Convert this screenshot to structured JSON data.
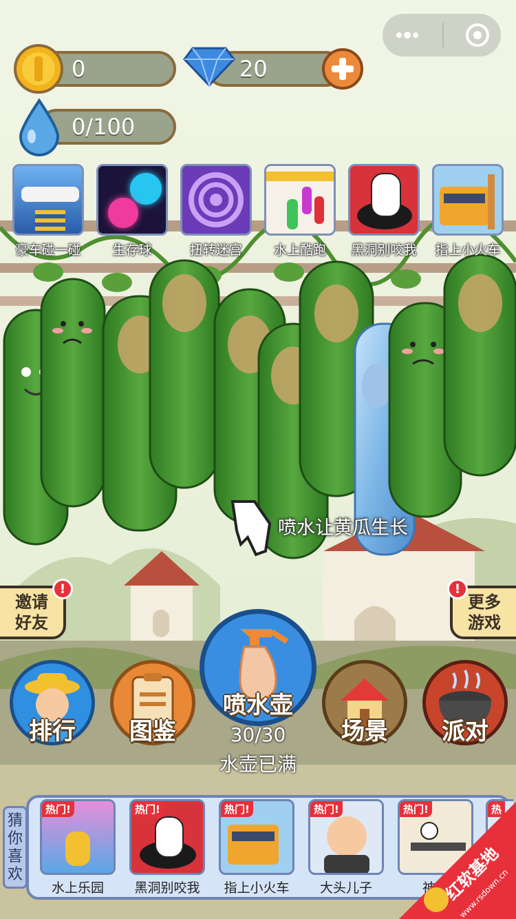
{
  "stats": {
    "coins": "0",
    "gems": "20",
    "water": "0/100"
  },
  "top_games": [
    {
      "label": "豪车碰一碰",
      "icon": "race-car-thumb"
    },
    {
      "label": "生存球",
      "icon": "neon-balls-thumb"
    },
    {
      "label": "扭转迷宫",
      "icon": "spiral-maze-thumb"
    },
    {
      "label": "水上酷跑",
      "icon": "water-run-thumb"
    },
    {
      "label": "黑洞别咬我",
      "icon": "black-hole-thumb"
    },
    {
      "label": "指上小火车",
      "icon": "train-thumb"
    }
  ],
  "hint": "喷水让黄瓜生长",
  "invite": {
    "line1": "邀请",
    "line2": "好友",
    "alert": "!"
  },
  "more_games": {
    "line1": "更多",
    "line2": "游戏",
    "alert": "!"
  },
  "buttons": {
    "rank": "排行",
    "catalog": "图鉴",
    "sprayer": "喷水壶",
    "scene": "场景",
    "party": "派对"
  },
  "sprayer_count": "30/30",
  "sprayer_status": "水壶已满",
  "recommend_tab": "猜你喜欢",
  "recommended": [
    {
      "label": "水上乐园",
      "hot": "热门!"
    },
    {
      "label": "黑洞别咬我",
      "hot": "热门!"
    },
    {
      "label": "指上小火车",
      "hot": "热门!"
    },
    {
      "label": "大头儿子",
      "hot": "热门!"
    },
    {
      "label": "神枪",
      "hot": "热门!"
    },
    {
      "label": "",
      "hot": "热"
    }
  ],
  "watermark": {
    "text": "红软基地",
    "url": "www.rsdown.cn"
  },
  "colors": {
    "sky": "#e9f0da",
    "cucumber": "#3f8f2e",
    "frozen_cucumber": "#8fc2ec",
    "pill_bg": "#9aa38c",
    "panel_border": "#6f84b4",
    "alert_red": "#e8303a"
  }
}
